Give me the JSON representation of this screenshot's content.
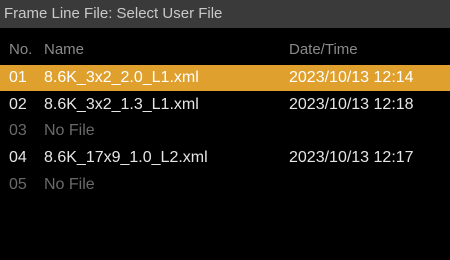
{
  "title": "Frame Line File: Select User File",
  "columns": {
    "no": "No.",
    "name": "Name",
    "datetime": "Date/Time"
  },
  "rows": [
    {
      "no": "01",
      "name": "8.6K_3x2_2.0_L1.xml",
      "datetime": "2023/10/13 12:14",
      "selected": true,
      "empty": false
    },
    {
      "no": "02",
      "name": "8.6K_3x2_1.3_L1.xml",
      "datetime": "2023/10/13 12:18",
      "selected": false,
      "empty": false
    },
    {
      "no": "03",
      "name": "No File",
      "datetime": "",
      "selected": false,
      "empty": true
    },
    {
      "no": "04",
      "name": "8.6K_17x9_1.0_L2.xml",
      "datetime": "2023/10/13 12:17",
      "selected": false,
      "empty": false
    },
    {
      "no": "05",
      "name": "No File",
      "datetime": "",
      "selected": false,
      "empty": true
    }
  ],
  "colors": {
    "titlebar": "#3a3a3a",
    "selected": "#e0a02e",
    "background": "#000000",
    "dim_text": "#6a6a6a"
  }
}
